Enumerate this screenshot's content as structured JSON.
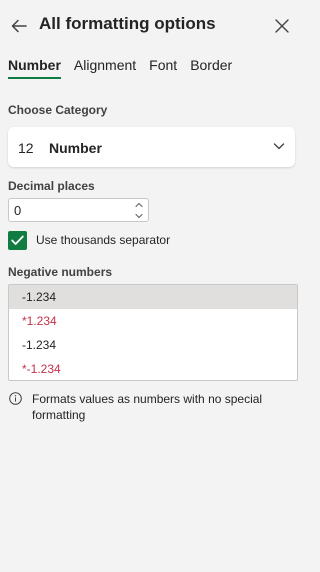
{
  "header": {
    "title": "All formatting options",
    "back_icon": "arrow-left-icon",
    "close_icon": "close-icon"
  },
  "tabs": [
    {
      "label": "Number",
      "active": true
    },
    {
      "label": "Alignment",
      "active": false
    },
    {
      "label": "Font",
      "active": false
    },
    {
      "label": "Border",
      "active": false
    }
  ],
  "category": {
    "label": "Choose Category",
    "icon_text": "12",
    "value": "Number"
  },
  "decimal": {
    "label": "Decimal places",
    "value": "0"
  },
  "thousands": {
    "label": "Use thousands separator",
    "checked": true
  },
  "negative": {
    "label": "Negative numbers",
    "options": [
      {
        "text": "-1.234",
        "selected": true,
        "red": false
      },
      {
        "text": "*1.234",
        "selected": false,
        "red": true
      },
      {
        "text": "-1.234",
        "selected": false,
        "red": false
      },
      {
        "text": "*-1.234",
        "selected": false,
        "red": true
      }
    ]
  },
  "info": {
    "text": "Formats values as numbers with no special formatting"
  },
  "colors": {
    "accent": "#107c41",
    "negative_red": "#c4314b",
    "background": "#f3f3f3"
  }
}
